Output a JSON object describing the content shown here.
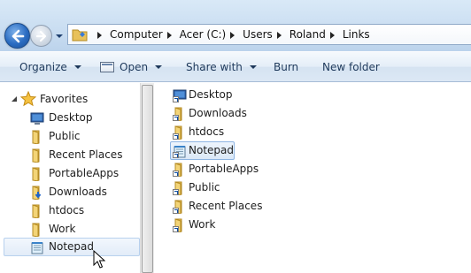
{
  "address": {
    "crumbs": [
      "Computer",
      "Acer (C:)",
      "Users",
      "Roland",
      "Links"
    ]
  },
  "toolbar": {
    "organize": "Organize",
    "open": "Open",
    "share_with": "Share with",
    "burn": "Burn",
    "new_folder": "New folder"
  },
  "nav": {
    "favorites_label": "Favorites",
    "items": [
      {
        "label": "Desktop",
        "icon": "desktop-icon"
      },
      {
        "label": "Public",
        "icon": "folder-icon"
      },
      {
        "label": "Recent Places",
        "icon": "folder-icon"
      },
      {
        "label": "PortableApps",
        "icon": "folder-icon"
      },
      {
        "label": "Downloads",
        "icon": "downloads-folder-icon"
      },
      {
        "label": "htdocs",
        "icon": "folder-icon"
      },
      {
        "label": "Work",
        "icon": "folder-icon"
      },
      {
        "label": "Notepad",
        "icon": "notepad-icon"
      }
    ],
    "selected_index": 7
  },
  "files": {
    "items": [
      {
        "label": "Desktop",
        "icon": "desktop-shortcut-icon"
      },
      {
        "label": "Downloads",
        "icon": "folder-shortcut-icon"
      },
      {
        "label": "htdocs",
        "icon": "folder-shortcut-icon"
      },
      {
        "label": "Notepad",
        "icon": "notepad-shortcut-icon"
      },
      {
        "label": "PortableApps",
        "icon": "folder-shortcut-icon"
      },
      {
        "label": "Public",
        "icon": "folder-shortcut-icon"
      },
      {
        "label": "Recent Places",
        "icon": "folder-shortcut-icon"
      },
      {
        "label": "Work",
        "icon": "folder-shortcut-icon"
      }
    ],
    "selected_index": 3
  },
  "colors": {
    "accent": "#2a6cc2",
    "selection_border": "#8db4e2",
    "toolbar_text": "#1e395b",
    "folder": "#e8c15a"
  }
}
